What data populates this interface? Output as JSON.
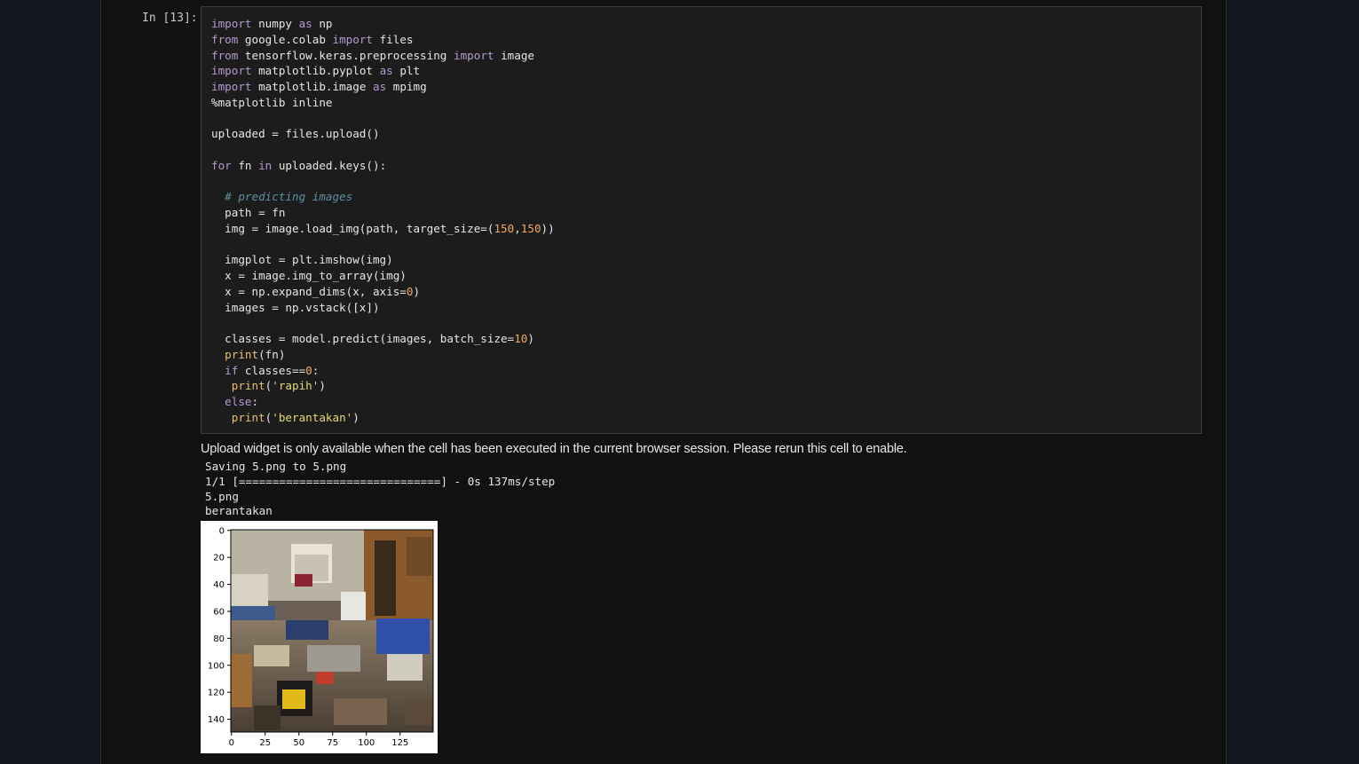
{
  "cell": {
    "prompt": "In [13]:",
    "code_lines": [
      [
        [
          "kw",
          "import"
        ],
        [
          "t",
          " numpy "
        ],
        [
          "kw",
          "as"
        ],
        [
          "t",
          " np"
        ]
      ],
      [
        [
          "kw",
          "from"
        ],
        [
          "t",
          " google.colab "
        ],
        [
          "kw",
          "import"
        ],
        [
          "t",
          " files"
        ]
      ],
      [
        [
          "kw",
          "from"
        ],
        [
          "t",
          " tensorflow.keras.preprocessing "
        ],
        [
          "kw",
          "import"
        ],
        [
          "t",
          " image"
        ]
      ],
      [
        [
          "kw",
          "import"
        ],
        [
          "t",
          " matplotlib.pyplot "
        ],
        [
          "kw",
          "as"
        ],
        [
          "t",
          " plt"
        ]
      ],
      [
        [
          "kw",
          "import"
        ],
        [
          "t",
          " matplotlib.image "
        ],
        [
          "kw",
          "as"
        ],
        [
          "t",
          " mpimg"
        ]
      ],
      [
        [
          "t",
          "%matplotlib inline"
        ]
      ],
      [],
      [
        [
          "t",
          "uploaded = files.upload()"
        ]
      ],
      [],
      [
        [
          "kw",
          "for"
        ],
        [
          "t",
          " fn "
        ],
        [
          "kw",
          "in"
        ],
        [
          "t",
          " uploaded.keys():"
        ]
      ],
      [],
      [
        [
          "t",
          "  "
        ],
        [
          "com",
          "# predicting images"
        ]
      ],
      [
        [
          "t",
          "  path = fn"
        ]
      ],
      [
        [
          "t",
          "  img = image.load_img(path, target_size=("
        ],
        [
          "num",
          "150"
        ],
        [
          "t",
          ","
        ],
        [
          "num",
          "150"
        ],
        [
          "t",
          "))"
        ]
      ],
      [],
      [
        [
          "t",
          "  imgplot = plt.imshow(img)"
        ]
      ],
      [
        [
          "t",
          "  x = image.img_to_array(img)"
        ]
      ],
      [
        [
          "t",
          "  x = np.expand_dims(x, axis="
        ],
        [
          "num",
          "0"
        ],
        [
          "t",
          ")"
        ]
      ],
      [
        [
          "t",
          "  images = np.vstack([x])"
        ]
      ],
      [],
      [
        [
          "t",
          "  classes = model.predict(images, batch_size="
        ],
        [
          "num",
          "10"
        ],
        [
          "t",
          ")"
        ]
      ],
      [
        [
          "t",
          "  "
        ],
        [
          "fn",
          "print"
        ],
        [
          "t",
          "(fn)"
        ]
      ],
      [
        [
          "t",
          "  "
        ],
        [
          "kw",
          "if"
        ],
        [
          "t",
          " classes=="
        ],
        [
          "num",
          "0"
        ],
        [
          "t",
          ":"
        ]
      ],
      [
        [
          "t",
          "   "
        ],
        [
          "fn",
          "print"
        ],
        [
          "t",
          "("
        ],
        [
          "str",
          "'rapih'"
        ],
        [
          "t",
          ")"
        ]
      ],
      [
        [
          "t",
          "  "
        ],
        [
          "kw",
          "else"
        ],
        [
          "t",
          ":"
        ]
      ],
      [
        [
          "t",
          "   "
        ],
        [
          "fn",
          "print"
        ],
        [
          "t",
          "("
        ],
        [
          "str",
          "'berantakan'"
        ],
        [
          "t",
          ")"
        ]
      ]
    ]
  },
  "output": {
    "notice": "Upload widget is only available when the cell has been executed in the current browser session. Please rerun this cell to enable.",
    "stream_lines": [
      "Saving 5.png to 5.png",
      "1/1 [==============================] - 0s 137ms/step",
      "5.png",
      "berantakan"
    ]
  },
  "figure": {
    "y_ticks": [
      "0",
      "20",
      "40",
      "60",
      "80",
      "100",
      "120",
      "140"
    ],
    "x_ticks": [
      "0",
      "25",
      "50",
      "75",
      "100",
      "125"
    ],
    "image_description_icon": "messy-room-photo"
  },
  "colors": {
    "background": "#111111",
    "code_bg": "#1c1c1c",
    "keyword": "#b49ad0",
    "number": "#f0a95c",
    "string": "#e6db74",
    "comment": "#5f8fa0"
  }
}
